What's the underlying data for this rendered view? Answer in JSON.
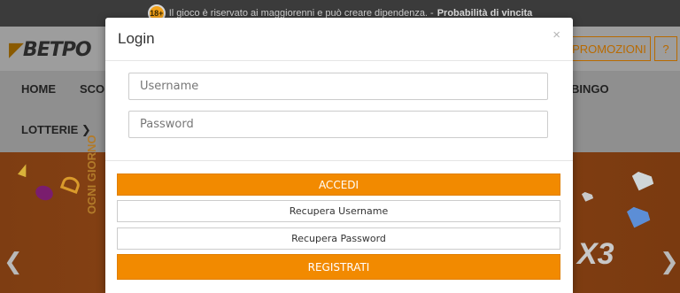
{
  "topbar": {
    "age_badge": "18+",
    "notice": "Il gioco è riservato ai maggiorenni e può creare dipendenza. -",
    "link": "Probabilità di vincita"
  },
  "header": {
    "logo": "BETPO",
    "promo_label": "PROMOZIONI",
    "help_label": "?"
  },
  "nav": {
    "items": [
      "HOME",
      "SCO",
      "BINGO",
      "LOTTERIE ❯"
    ]
  },
  "banner": {
    "vertical_text": "OGNI GIORNO",
    "multiplier": "X3",
    "prev_arrow": "❮",
    "next_arrow": "❯"
  },
  "modal": {
    "title": "Login",
    "close": "×",
    "username_placeholder": "Username",
    "password_placeholder": "Password",
    "login_button": "ACCEDI",
    "recover_username": "Recupera Username",
    "recover_password": "Recupera Password",
    "register_button": "REGISTRATI"
  },
  "colors": {
    "accent": "#f28a00",
    "dim_overlay": "#3b3b3b"
  }
}
